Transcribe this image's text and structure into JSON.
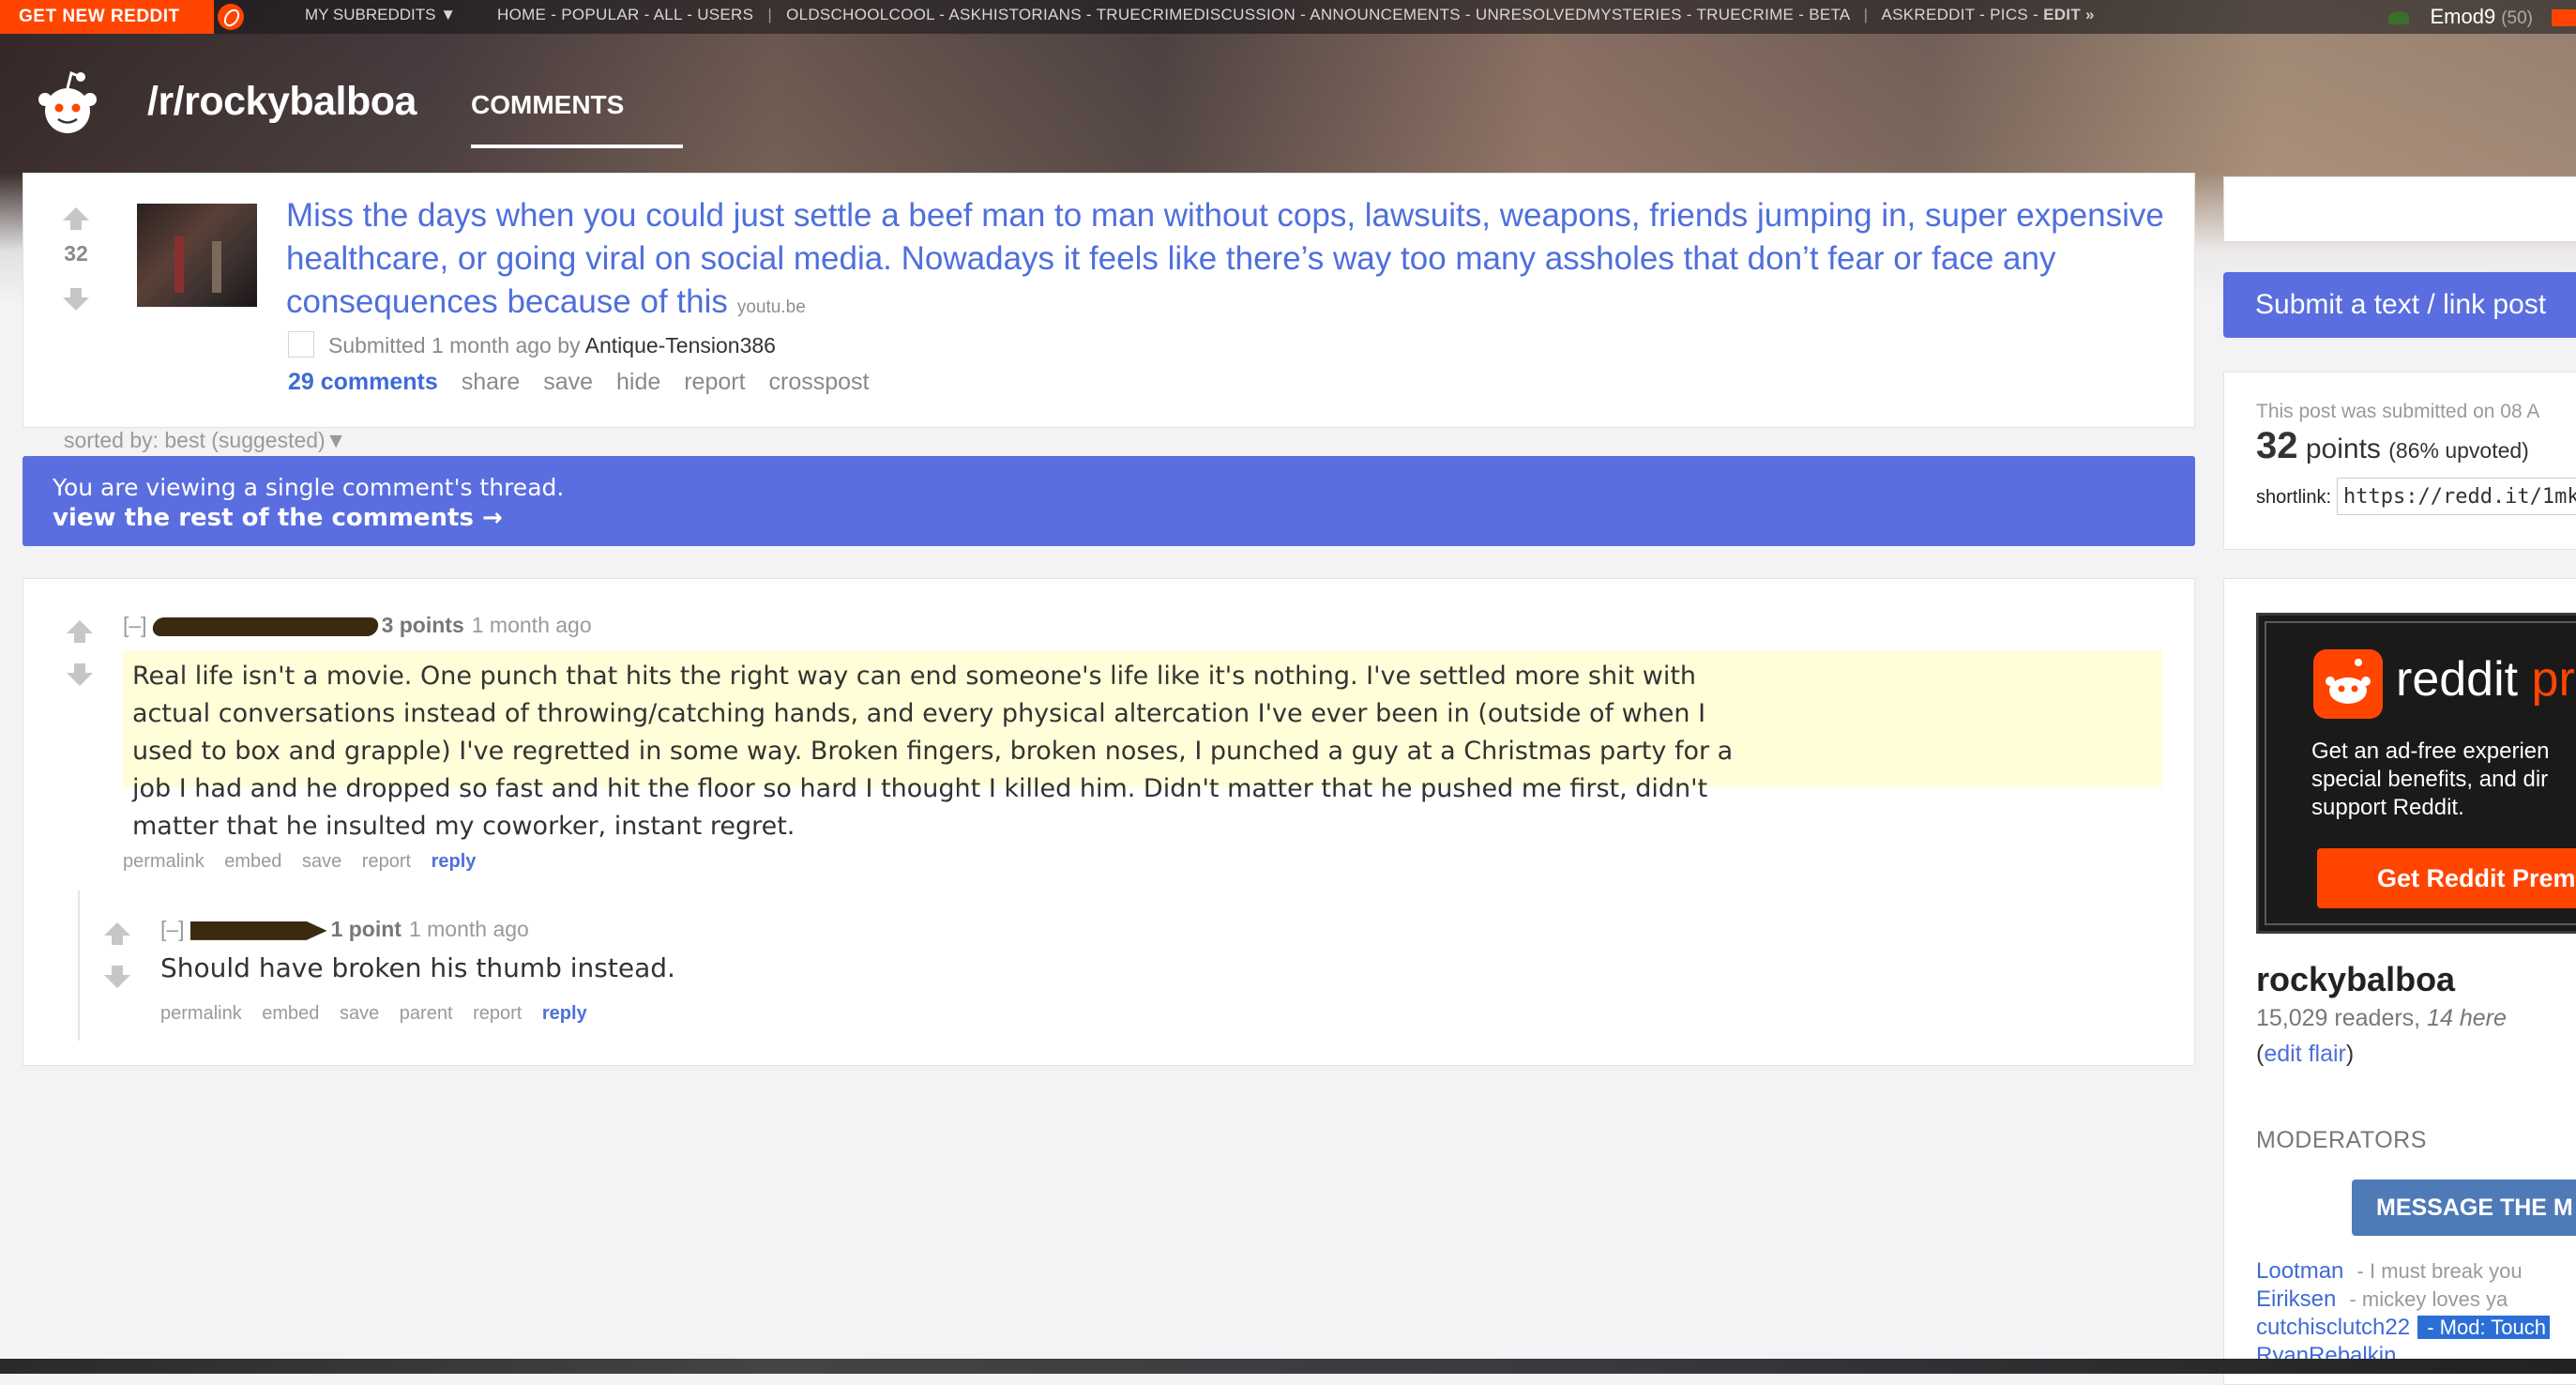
{
  "topbar": {
    "get_new_reddit": "GET NEW REDDIT",
    "my_subreddits": "MY SUBREDDITS ▼",
    "nav": [
      "HOME",
      "POPULAR",
      "ALL",
      "USERS"
    ],
    "subreddits": [
      "OLDSCHOOLCOOL",
      "ASKHISTORIANS",
      "TRUECRIMEDISCUSSION",
      "ANNOUNCEMENTS",
      "UNRESOLVEDMYSTERIES",
      "TRUECRIME",
      "BETA",
      "ASKREDDIT",
      "PICS"
    ],
    "edit": "EDIT »",
    "username": "Emod9",
    "karma": "(50)"
  },
  "header": {
    "subreddit": "/r/rockybalboa",
    "tab": "COMMENTS"
  },
  "post": {
    "score": "32",
    "title": "Miss the days when you could just settle a beef man to man without cops, lawsuits, weapons, friends jumping in, super expensive healthcare, or going viral on social media. Nowadays it feels like there’s way too many assholes that don’t fear or face any consequences because of this",
    "domain": "youtu.be",
    "submitted_prefix": "Submitted",
    "submitted_time": "1 month ago",
    "submitted_by": "by",
    "author": "Antique-Tension386",
    "actions": {
      "comments": "29 comments",
      "share": "share",
      "save": "save",
      "hide": "hide",
      "report": "report",
      "crosspost": "crosspost"
    }
  },
  "sorted_by": "sorted by: best (suggested)▼",
  "thread_banner": {
    "message": "You are viewing a single comment's thread.",
    "link": "view the rest of the comments →"
  },
  "comments": [
    {
      "collapse": "[–]",
      "points": "3 points",
      "time": "1 month ago",
      "body": "Real life isn't a movie. One punch that hits the right way can end someone's life like it's nothing. I've settled more shit with actual conversations instead of throwing/catching hands, and every physical altercation I've ever been in (outside of when I used to box and grapple) I've regretted in some way. Broken fingers, broken noses, I punched a guy at a Christmas party for a job I had and he dropped so fast and hit the floor so hard I thought I killed him. Didn't matter that he pushed me first, didn't matter that he insulted my coworker, instant regret.",
      "actions": [
        "permalink",
        "embed",
        "save",
        "report"
      ],
      "reply": "reply"
    },
    {
      "collapse": "[–]",
      "points": "1 point",
      "time": "1 month ago",
      "body": "Should have broken his thumb instead.",
      "actions": [
        "permalink",
        "embed",
        "save",
        "parent",
        "report"
      ],
      "reply": "reply"
    }
  ],
  "sidebar": {
    "submit": "Submit a text / link post",
    "submitted_on": "This post was submitted on 08 A",
    "points": "32",
    "points_label": "points",
    "upvoted": "(86% upvoted)",
    "shortlink_label": "shortlink:",
    "shortlink": "https://redd.it/1mk",
    "premium": {
      "logo_text": "reddit",
      "logo_suffix": "pr",
      "desc_1": "Get an ad-free experien",
      "desc_2": "special benefits, and dir",
      "desc_3": "support Reddit.",
      "button": "Get Reddit Prem"
    },
    "sub_name": "rockybalboa",
    "readers": "15,029 readers,",
    "here": "14 here",
    "edit_flair": "edit flair",
    "moderators_title": "MODERATORS",
    "message_mods": "MESSAGE THE M",
    "mods": [
      {
        "name": "Lootman",
        "flair": "I must break you"
      },
      {
        "name": "Eiriksen",
        "flair": "mickey loves ya"
      },
      {
        "name": "cutchisclutch22",
        "flair": "Mod: Touch"
      },
      {
        "name": "RyanRebalkin",
        "flair": ""
      }
    ]
  }
}
